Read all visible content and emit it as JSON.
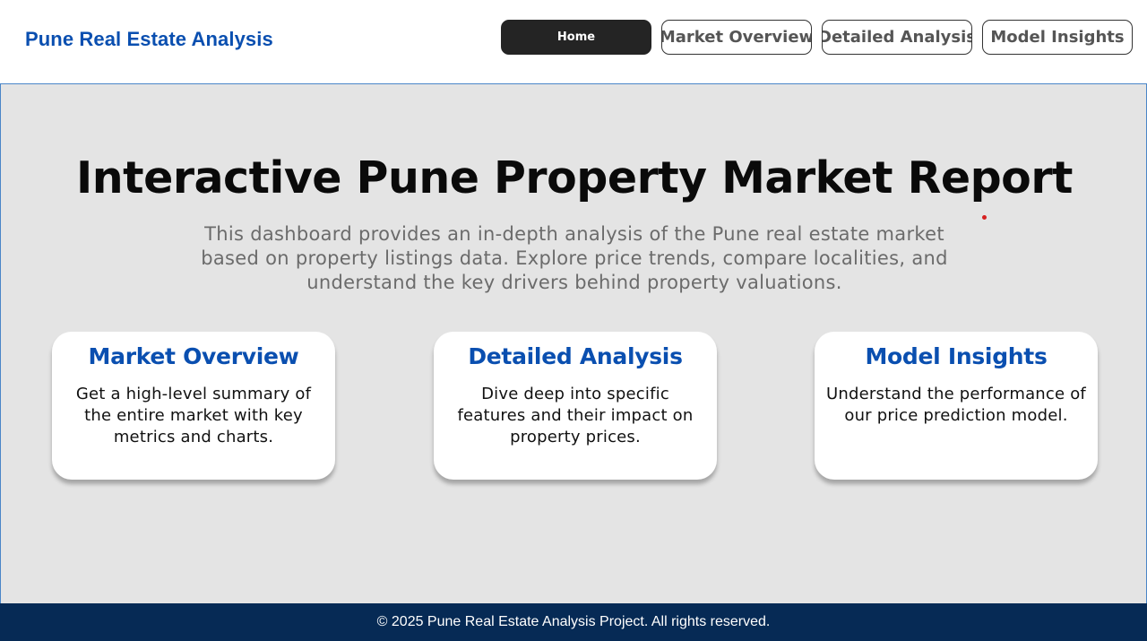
{
  "header": {
    "brand": "Pune Real Estate Analysis",
    "nav": [
      {
        "label": "Home",
        "active": true
      },
      {
        "label": "Market Overview",
        "active": false
      },
      {
        "label": "Detailed Analysis",
        "active": false
      },
      {
        "label": "Model Insights",
        "active": false
      }
    ]
  },
  "hero": {
    "title": "Interactive Pune Property Market Report",
    "subtitle": "This dashboard provides an in-depth analysis of the Pune real estate market based on property listings data. Explore price trends, compare localities, and understand the key drivers behind property valuations."
  },
  "cards": [
    {
      "title": "Market Overview",
      "description": "Get a high-level summary of the entire market with key metrics and charts."
    },
    {
      "title": "Detailed Analysis",
      "description": "Dive deep into specific features and their impact on property prices."
    },
    {
      "title": "Model Insights",
      "description": "Understand the performance of our price prediction model."
    }
  ],
  "footer": {
    "text": "© 2025 Pune Real Estate Analysis Project. All rights reserved."
  },
  "colors": {
    "brand_blue": "#0a4fb0",
    "active_nav": "#242424",
    "main_bg": "#e4e4e4",
    "footer_bg": "#062a55"
  }
}
